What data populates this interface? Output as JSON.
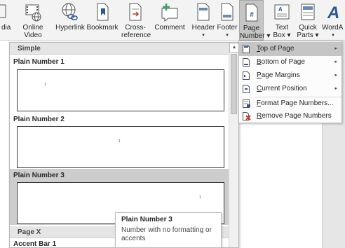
{
  "ribbon": {
    "buttons": [
      {
        "name": "media-partial",
        "line1": "dia",
        "line2": "",
        "icon": "media-icon"
      },
      {
        "name": "online-video",
        "line1": "Online",
        "line2": "Video",
        "icon": "online-video-icon"
      },
      {
        "name": "hyperlink",
        "line1": "Hyperlink",
        "line2": "",
        "icon": "hyperlink-icon"
      },
      {
        "name": "bookmark",
        "line1": "Bookmark",
        "line2": "",
        "icon": "bookmark-icon"
      },
      {
        "name": "cross-reference",
        "line1": "Cross-",
        "line2": "reference",
        "icon": "cross-reference-icon"
      },
      {
        "name": "comment",
        "line1": "Comment",
        "line2": "",
        "icon": "comment-icon"
      },
      {
        "name": "header",
        "line1": "Header",
        "line2": "▾",
        "icon": "header-icon"
      },
      {
        "name": "footer",
        "line1": "Footer",
        "line2": "▾",
        "icon": "footer-icon"
      },
      {
        "name": "page-number",
        "line1": "Page",
        "line2": "Number ▾",
        "icon": "page-number-icon"
      },
      {
        "name": "text-box",
        "line1": "Text",
        "line2": "Box ▾",
        "icon": "text-box-icon"
      },
      {
        "name": "quick-parts",
        "line1": "Quick",
        "line2": "Parts ▾",
        "icon": "quick-parts-icon"
      },
      {
        "name": "wordart",
        "line1": "WordA",
        "line2": "▾",
        "icon": "wordart-icon"
      }
    ]
  },
  "gallery": {
    "section_simple": "Simple",
    "items": [
      {
        "title": "Plain Number 1",
        "num": "1"
      },
      {
        "title": "Plain Number 2",
        "num": "1"
      },
      {
        "title": "Plain Number 3",
        "num": "1"
      }
    ],
    "section_pagex": "Page X",
    "next_item": "Accent Bar 1"
  },
  "tooltip": {
    "title": "Plain Number 3",
    "description": "Number with no formatting or accents"
  },
  "menu": {
    "items": [
      {
        "label": "Top of Page",
        "mnemonic": "T",
        "rest": "op of Page",
        "icon": "top-of-page-icon",
        "submenu": true
      },
      {
        "label": "Bottom of Page",
        "mnemonic": "B",
        "rest": "ottom of Page",
        "icon": "bottom-of-page-icon",
        "submenu": true
      },
      {
        "label": "Page Margins",
        "mnemonic": "P",
        "rest": "age Margins",
        "icon": "page-margins-icon",
        "submenu": true
      },
      {
        "label": "Current Position",
        "mnemonic": "C",
        "rest": "urrent Position",
        "icon": "current-position-icon",
        "submenu": true
      },
      {
        "label": "Format Page Numbers...",
        "mnemonic": "F",
        "rest": "ormat Page Numbers...",
        "icon": "format-page-numbers-icon",
        "submenu": false
      },
      {
        "label": "Remove Page Numbers",
        "mnemonic": "R",
        "rest": "emove Page Numbers",
        "icon": "remove-page-numbers-icon",
        "submenu": false
      }
    ],
    "submenu_arrow": "▸"
  },
  "colors": {
    "active_button": "#c5c5c5",
    "selected_item": "#cdcdcd",
    "remove_icon": "#c0392b",
    "comment_plus": "#3ca06a"
  }
}
